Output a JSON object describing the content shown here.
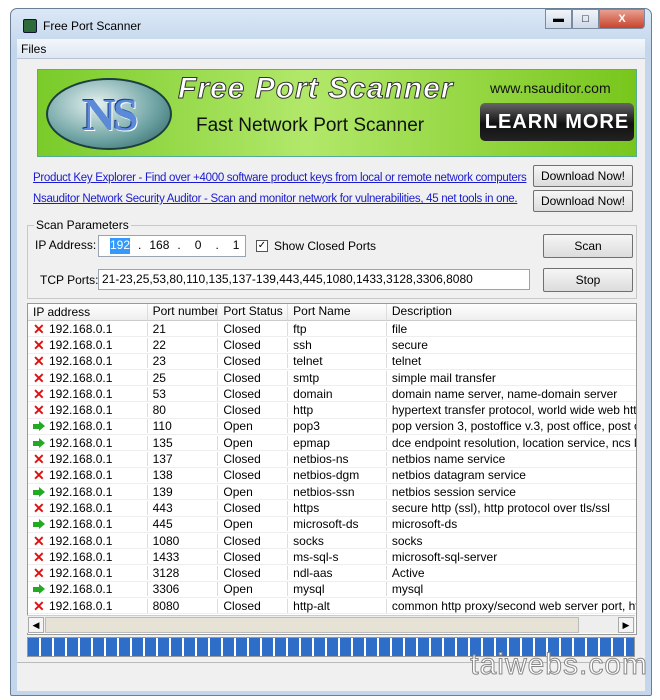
{
  "window": {
    "title": "Free Port Scanner"
  },
  "menu": {
    "files": "Files"
  },
  "banner": {
    "title": "Free Port Scanner",
    "subtitle": "Fast Network Port Scanner",
    "url": "www.nsauditor.com",
    "learn_more": "LEARN MORE",
    "logo_text": "NS"
  },
  "links": [
    {
      "text": "Product Key Explorer - Find over +4000 software product keys from local or  remote network computers",
      "button": "Download Now!"
    },
    {
      "text": "Nsauditor Network Security Auditor - Scan and monitor network for vulnerabilities, 45 net tools in one.",
      "button": "Download Now!"
    }
  ],
  "scan": {
    "group_label": "Scan Parameters",
    "ip_label": "IP Address:",
    "ip": [
      "192",
      "168",
      "0",
      "1"
    ],
    "show_closed_label": "Show Closed Ports",
    "show_closed_checked": true,
    "tcp_label": "TCP Ports:",
    "tcp_ports": "21-23,25,53,80,110,135,137-139,443,445,1080,1433,3128,3306,8080",
    "scan_button": "Scan",
    "stop_button": "Stop"
  },
  "table": {
    "columns": [
      "IP address",
      "Port number",
      "Port Status",
      "Port Name",
      "Description"
    ],
    "rows": [
      [
        "192.168.0.1",
        "21",
        "Closed",
        "ftp",
        "file"
      ],
      [
        "192.168.0.1",
        "22",
        "Closed",
        "ssh",
        "secure"
      ],
      [
        "192.168.0.1",
        "23",
        "Closed",
        "telnet",
        "telnet"
      ],
      [
        "192.168.0.1",
        "25",
        "Closed",
        "smtp",
        "simple mail transfer"
      ],
      [
        "192.168.0.1",
        "53",
        "Closed",
        "domain",
        "domain name server, name-domain server"
      ],
      [
        "192.168.0.1",
        "80",
        "Closed",
        "http",
        "hypertext transfer protocol, world wide web http"
      ],
      [
        "192.168.0.1",
        "110",
        "Open",
        "pop3",
        "pop version 3, postoffice v.3, post office, post office"
      ],
      [
        "192.168.0.1",
        "135",
        "Open",
        "epmap",
        "dce endpoint resolution, location service, ncs local"
      ],
      [
        "192.168.0.1",
        "137",
        "Closed",
        "netbios-ns",
        "netbios name service"
      ],
      [
        "192.168.0.1",
        "138",
        "Closed",
        "netbios-dgm",
        "netbios datagram service"
      ],
      [
        "192.168.0.1",
        "139",
        "Open",
        "netbios-ssn",
        "netbios session service"
      ],
      [
        "192.168.0.1",
        "443",
        "Closed",
        "https",
        "secure http (ssl), http protocol over tls/ssl"
      ],
      [
        "192.168.0.1",
        "445",
        "Open",
        "microsoft-ds",
        "microsoft-ds"
      ],
      [
        "192.168.0.1",
        "1080",
        "Closed",
        "socks",
        "socks"
      ],
      [
        "192.168.0.1",
        "1433",
        "Closed",
        "ms-sql-s",
        "microsoft-sql-server"
      ],
      [
        "192.168.0.1",
        "3128",
        "Closed",
        "ndl-aas",
        "Active"
      ],
      [
        "192.168.0.1",
        "3306",
        "Open",
        "mysql",
        "mysql"
      ],
      [
        "192.168.0.1",
        "8080",
        "Closed",
        "http-alt",
        "common http proxy/second web server port, http al"
      ]
    ]
  },
  "progress": {
    "percent": 100,
    "color": "#2f6ec8"
  },
  "icons": {
    "open": "green-arrow-icon",
    "closed": "red-x-icon"
  },
  "watermark": "taiwebs.com"
}
